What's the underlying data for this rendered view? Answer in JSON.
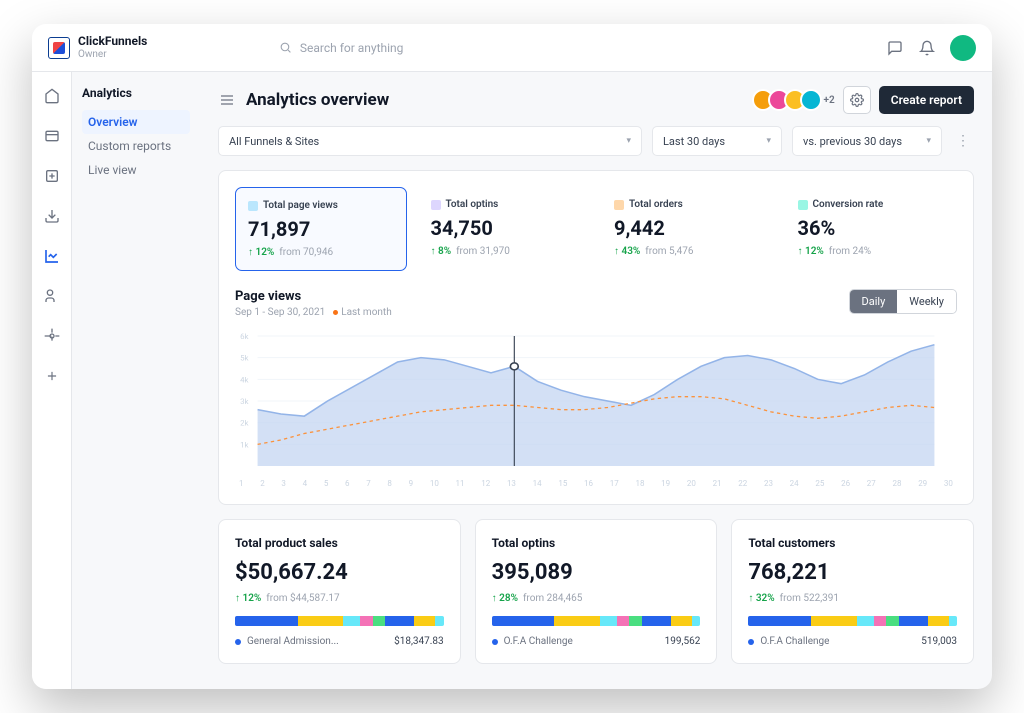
{
  "brand": {
    "name": "ClickFunnels",
    "role": "Owner"
  },
  "search": {
    "placeholder": "Search for anything"
  },
  "sidebar": {
    "title": "Analytics",
    "items": [
      "Overview",
      "Custom reports",
      "Live view"
    ]
  },
  "page": {
    "title": "Analytics overview",
    "avatars_more": "+2",
    "create_btn": "Create report"
  },
  "filters": {
    "funnels": "All Funnels & Sites",
    "range": "Last 30 days",
    "compare": "vs. previous 30 days"
  },
  "kpis": [
    {
      "label": "Total page views",
      "value": "71,897",
      "change": "12%",
      "from": "from 70,946",
      "color": "#bae6fd"
    },
    {
      "label": "Total optins",
      "value": "34,750",
      "change": "8%",
      "from": "from 31,970",
      "color": "#ddd6fe"
    },
    {
      "label": "Total orders",
      "value": "9,442",
      "change": "43%",
      "from": "from 5,476",
      "color": "#fed7aa"
    },
    {
      "label": "Conversion rate",
      "value": "36%",
      "change": "12%",
      "from": "from 24%",
      "color": "#99f6e4"
    }
  ],
  "chart": {
    "title": "Page views",
    "subtitle": "Sep 1 - Sep 30, 2021",
    "legend": "Last month",
    "toggle": {
      "daily": "Daily",
      "weekly": "Weekly"
    }
  },
  "chart_data": {
    "type": "area",
    "x": [
      1,
      2,
      3,
      4,
      5,
      6,
      7,
      8,
      9,
      10,
      11,
      12,
      13,
      14,
      15,
      16,
      17,
      18,
      19,
      20,
      21,
      22,
      23,
      24,
      25,
      26,
      27,
      28,
      29,
      30
    ],
    "ylim": [
      0,
      6
    ],
    "ylabel": "k",
    "series": [
      {
        "name": "Page views",
        "values": [
          2.6,
          2.4,
          2.3,
          3.0,
          3.6,
          4.2,
          4.8,
          5.0,
          4.9,
          4.6,
          4.3,
          4.6,
          3.9,
          3.5,
          3.2,
          3.0,
          2.8,
          3.3,
          4.0,
          4.6,
          5.0,
          5.1,
          4.9,
          4.5,
          4.0,
          3.8,
          4.2,
          4.8,
          5.3,
          5.6
        ]
      },
      {
        "name": "Last month",
        "values": [
          1.0,
          1.2,
          1.5,
          1.7,
          1.9,
          2.1,
          2.3,
          2.5,
          2.6,
          2.7,
          2.8,
          2.8,
          2.7,
          2.6,
          2.6,
          2.7,
          2.9,
          3.1,
          3.2,
          3.2,
          3.1,
          2.8,
          2.5,
          2.3,
          2.2,
          2.3,
          2.5,
          2.7,
          2.8,
          2.7
        ]
      }
    ],
    "yticks": [
      "1k",
      "2k",
      "3k",
      "4k",
      "5k",
      "6k"
    ]
  },
  "cards": [
    {
      "title": "Total product sales",
      "value": "$50,667.24",
      "change": "12%",
      "from": "from $44,587.17",
      "item_label": "General Admission...",
      "item_value": "$18,347.83"
    },
    {
      "title": "Total optins",
      "value": "395,089",
      "change": "28%",
      "from": "from 284,465",
      "item_label": "O.F.A Challenge",
      "item_value": "199,562"
    },
    {
      "title": "Total customers",
      "value": "768,221",
      "change": "32%",
      "from": "from 522,391",
      "item_label": "O.F.A Challenge",
      "item_value": "519,003"
    }
  ],
  "segbar": [
    {
      "c": "#2563eb",
      "w": 30
    },
    {
      "c": "#facc15",
      "w": 22
    },
    {
      "c": "#67e8f9",
      "w": 8
    },
    {
      "c": "#f472b6",
      "w": 6
    },
    {
      "c": "#4ade80",
      "w": 6
    },
    {
      "c": "#2563eb",
      "w": 14
    },
    {
      "c": "#facc15",
      "w": 10
    },
    {
      "c": "#67e8f9",
      "w": 4
    }
  ]
}
